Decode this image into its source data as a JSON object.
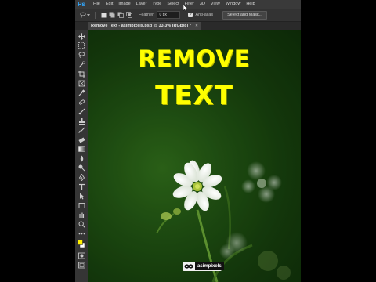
{
  "app": {
    "logo": "Ps"
  },
  "menu": [
    "File",
    "Edit",
    "Image",
    "Layer",
    "Type",
    "Select",
    "Filter",
    "3D",
    "View",
    "Window",
    "Help"
  ],
  "options": {
    "feather_label": "Feather:",
    "feather_value": "0 px",
    "antialias_label": "Anti-alias",
    "antialias_checked": true,
    "select_mask_label": "Select and Mask..."
  },
  "document": {
    "tab_title": "Remove Text - asimpixels.psd @ 33.3% (RGB/8) *",
    "close_symbol": "×"
  },
  "tools": [
    "move-icon",
    "marquee-icon",
    "lasso-icon",
    "quick-select-icon",
    "crop-icon",
    "frame-icon",
    "eyedropper-icon",
    "healing-brush-icon",
    "brush-icon",
    "clone-stamp-icon",
    "history-brush-icon",
    "eraser-icon",
    "gradient-icon",
    "blur-icon",
    "dodge-icon",
    "pen-icon",
    "type-icon",
    "path-select-icon",
    "rectangle-icon",
    "hand-icon",
    "zoom-icon",
    "more-tools-icon",
    "color-swatches-icon",
    "quick-mask-icon",
    "screen-mode-icon"
  ],
  "colors": {
    "foreground": "#ffef00",
    "background": "#ffffff",
    "headline": "#ffff00",
    "accent": "#31a8ff"
  },
  "canvas": {
    "headline_line1": "REMOVE",
    "headline_line2": "TEXT",
    "watermark": "asimpixels"
  }
}
